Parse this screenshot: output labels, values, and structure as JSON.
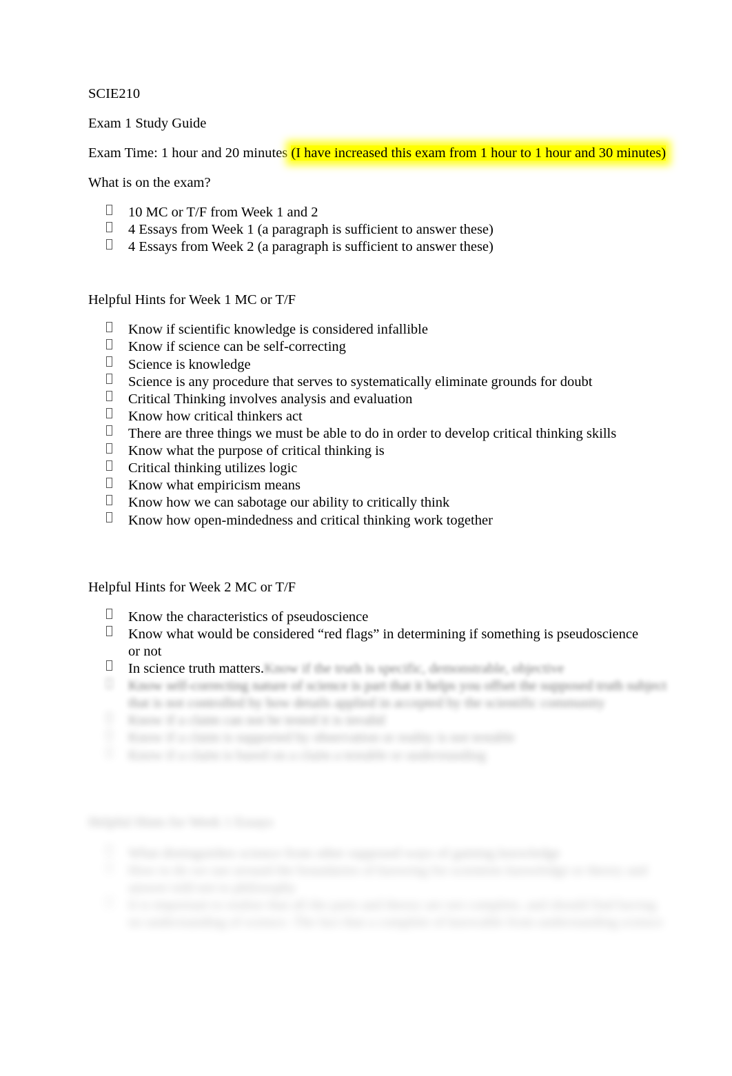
{
  "document": {
    "course_code": "SCIE210",
    "title": "Exam 1 Study Guide",
    "exam_time_label": "Exam Time: 1 hour and 20 minutes ",
    "exam_time_highlight": "(I have increased this exam from 1 hour to 1 hour and 30 minutes)",
    "whats_on_exam_heading": "What is on the exam?",
    "exam_contents": [
      "10 MC or T/F from Week 1 and 2",
      "4 Essays from Week 1 (a paragraph is sufficient to answer these)",
      "4 Essays from Week 2 (a paragraph is sufficient to answer these)"
    ],
    "week1_heading": "Helpful Hints for Week 1 MC or T/F",
    "week1_hints": [
      "Know if scientific knowledge is considered infallible",
      "Know if science can be self-correcting",
      "Science is knowledge",
      "Science is any procedure that serves to systematically eliminate grounds for doubt",
      "Critical Thinking involves analysis and evaluation",
      "Know how critical thinkers act",
      "There are three things we must be able to do in order to develop critical thinking skills",
      "Know what the purpose of critical thinking is",
      "Critical thinking utilizes logic",
      "Know what empiricism means",
      "Know how we can sabotage our ability to critically think",
      "Know how open-mindedness and critical thinking work together"
    ],
    "week2_heading": "Helpful Hints for Week 2 MC or T/F",
    "week2_hints": [
      "Know the characteristics of pseudoscience",
      "Know what would be considered “red flags” in determining if something is pseudoscience or not",
      "In science truth matters."
    ],
    "obscured_note": "Remaining content is obscured by a progressive blur and is not legible.",
    "obscured_lines": [
      "Know if the truth is specific, demonstrable, objective",
      "Know self-correcting nature of science is part that it helps you offset the supposed truth subject",
      "that is not controlled by how details applied in accepted by the scientific community",
      "Know if a claim can not be tested it is invalid",
      "Know if a claim is supported by observation or reality is not testable",
      "Know if a claim is based on a claim a testable or understanding"
    ],
    "obscured_heading": "Helpful Hints for Week 1 Essays",
    "obscured_tail_lines": [
      "What distinguishes science from other supposed ways of gaining knowledge",
      "How to do we use around the boundaries of knowing for scientists knowledge or theory and",
      "answer told not to philosophy",
      "It is important to realize that all the parts and theory are not complete, and should find having",
      "no understanding of science. The fact that a complete of knowable from understanding science"
    ],
    "colors": {
      "highlight": "#ffff00",
      "text": "#000000",
      "page_background": "#ffffff"
    }
  }
}
